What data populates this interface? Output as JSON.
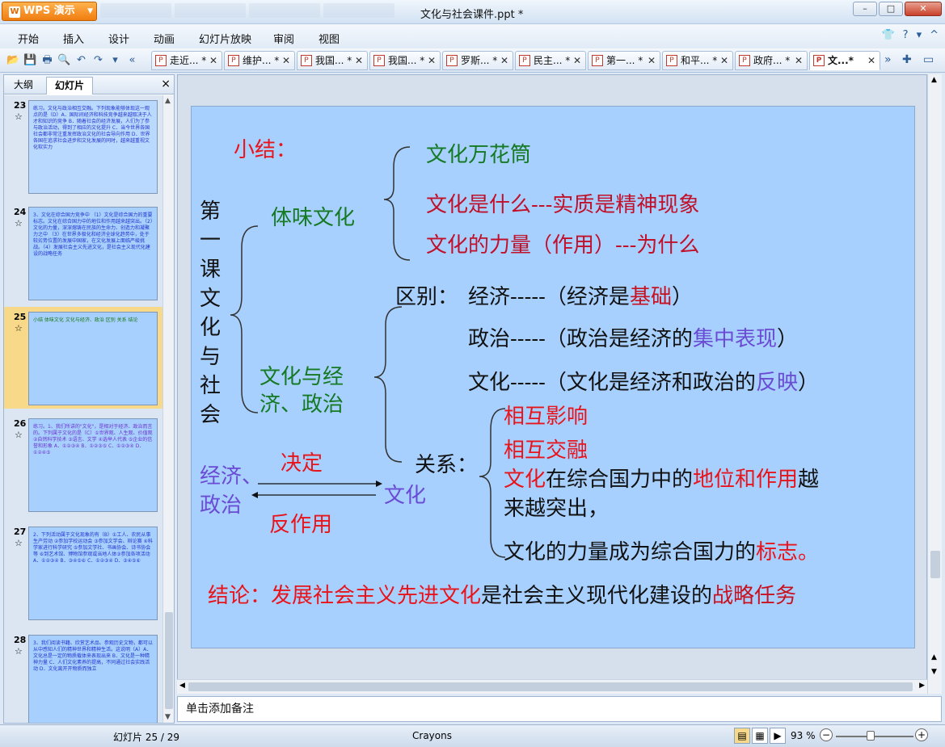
{
  "window": {
    "app_button": "WPS 演示",
    "doc_title": "文化与社会课件.ppt *",
    "controls": {
      "minimize": "–",
      "maximize": "□",
      "close": "✕"
    }
  },
  "menu": {
    "items": [
      "开始",
      "插入",
      "设计",
      "动画",
      "幻灯片放映",
      "审阅",
      "视图"
    ]
  },
  "toolbar": {
    "tabs": [
      {
        "label": "走近...",
        "modified": "*"
      },
      {
        "label": "维护...",
        "modified": "*"
      },
      {
        "label": "我国...",
        "modified": "*"
      },
      {
        "label": "我国...",
        "modified": "*"
      },
      {
        "label": "罗斯...",
        "modified": "*"
      },
      {
        "label": "民主...",
        "modified": "*"
      },
      {
        "label": "第一...",
        "modified": "*"
      },
      {
        "label": "和平...",
        "modified": "*"
      },
      {
        "label": "政府...",
        "modified": "*"
      },
      {
        "label": "文...*",
        "modified": ""
      }
    ]
  },
  "left_pane": {
    "tab_outline": "大纲",
    "tab_slides": "幻灯片",
    "close": "×",
    "thumbnails": [
      {
        "num": "23",
        "text": "练习。文化与政治相互交融。下列现象能够体现这一观点的是（D）A．国际间经济和科技竞争越来越取决于人才和知识的竞争 B．随着社会的经济发展，人们为了参与政治活动，得到了相应的文化提升 C．当今世界各国社会都非常注重发挥政治文化的社会导向作用 D．世界各国在追求社会进步和文化发展的同时，越来越重视文化软实力"
      },
      {
        "num": "24",
        "text": "3、文化在综合国力竞争中 （1）文化是综合国力的重要标志。文化在综合国力中的地位和作用越来越突出。（2）文化的力量，深深熔铸在民族的生命力、创造力和凝聚力之中 （3）在世界多极化和经济全球化趋势中，处于较劣势位置的发展中国家，在文化发展上面临严峻挑战。（4）发展社会主义先进文化，是社会主义现代化建设的战略任务"
      },
      {
        "num": "25",
        "text": "小结 体味文化 文化与经济、政治 区别 关系 结论"
      },
      {
        "num": "26",
        "text": "练习。1、我们所讲的\"文化\"，是相对于经济、政治而言的。下列属于文化的是（C）①世界观、人生观、价值观 ②自然科学技术 ③语言、文学 ④选举人代表 ⑤企业的信誉和形象 A．①②③④ B．①②③⑤ C．①②③④ D．①②④⑤"
      },
      {
        "num": "27",
        "text": "2、下列活动属于文化现象的有（B）①工人、农民从事生产劳动 ②参加学校运动会 ③参加文学会、辩论赛 ④科学家进行科学研究 ⑤参加文学社、书画协会、诗书协会等 ⑥到艺术馆、博物馆参观或当地人体③参加各项活动 A．①②③④ B．③④⑤⑥ C．①②③④ D．③④⑤⑥"
      },
      {
        "num": "28",
        "text": "3、我们阅读书籍、欣赏艺术品、参观历史文物，都可以从中感知人们的精神世界和精神生活。这说明（A）A．文化总是一定的物质载体来表现出来 B．文化是一种精神力量 C．人们文化素养的提高，不同通过社会实践活动 D．文化离开开物质而独立"
      }
    ]
  },
  "slide": {
    "summary_label": "小结：",
    "lesson_title": "第一课 文化与社会",
    "branch1": "体味文化",
    "kaleidoscope": "文化万花筒",
    "what_is_prefix": "文化是什么",
    "what_is_dashes": "---",
    "what_is_answer": "实质是精神现象",
    "power_prefix": "文化的力量（作用）",
    "power_dashes": "---",
    "power_answer": "为什么",
    "branch2_line1": "文化与经",
    "branch2_line2": "济、政治",
    "diff_label": "区别：",
    "diff_econ_pre": "经济-----（经济是",
    "diff_econ_key": "基础",
    "diff_econ_post": "）",
    "diff_pol_pre": "政治-----（政治是经济的",
    "diff_pol_key": "集中表现",
    "diff_pol_post": "）",
    "diff_cult_pre": "文化-----（文化是经济和政治的",
    "diff_cult_key": "反映",
    "diff_cult_post": "）",
    "rel_label": "关系：",
    "rel_influence": "相互影响",
    "rel_merge": "相互交融",
    "rel_line3_a": "文化",
    "rel_line3_b": "在综合国力中的",
    "rel_line3_c": "地位和作用",
    "rel_line3_d": "越",
    "rel_line4": "来越突出，",
    "rel_line5_a": "文化的力量成为综合国力的",
    "rel_line5_b": "标志。",
    "econ_pol_1": "经济、",
    "econ_pol_2": "政治",
    "decides": "决定",
    "culture": "文化",
    "reaction": "反作用",
    "conclusion_a": "结论：发展社会主义先进文化",
    "conclusion_b": "是社会主义现代化建设的",
    "conclusion_c": "战略任务"
  },
  "notes": {
    "placeholder": "单击添加备注"
  },
  "status": {
    "slide_counter": "幻灯片 25 / 29",
    "theme": "Crayons",
    "zoom": "93 %"
  },
  "colors": {
    "slide_bg": "#a8d0fe",
    "red": "#e8141b",
    "green": "#157a23",
    "purple": "#6a4bd4"
  }
}
